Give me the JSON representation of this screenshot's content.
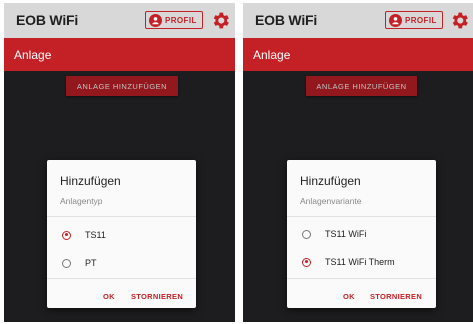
{
  "colors": {
    "accent": "#c42127",
    "topbar": "#d8d8d8",
    "background": "#27272a",
    "dialog": "#fafafa"
  },
  "screens": [
    {
      "app_title": "EOB WiFi",
      "profile_label": "PROFIL",
      "section_title": "Anlage",
      "add_button_label": "ANLAGE HINZUFÜGEN",
      "dialog": {
        "title": "Hinzufügen",
        "subtitle": "Anlagentyp",
        "options": [
          {
            "label": "TS11",
            "selected": true
          },
          {
            "label": "PT",
            "selected": false
          }
        ],
        "ok_label": "OK",
        "cancel_label": "STORNIEREN"
      }
    },
    {
      "app_title": "EOB WiFi",
      "profile_label": "PROFIL",
      "section_title": "Anlage",
      "add_button_label": "ANLAGE HINZUFÜGEN",
      "dialog": {
        "title": "Hinzufügen",
        "subtitle": "Anlagenvariante",
        "options": [
          {
            "label": "TS11 WiFi",
            "selected": false
          },
          {
            "label": "TS11 WiFi Therm",
            "selected": true
          }
        ],
        "ok_label": "OK",
        "cancel_label": "STORNIEREN"
      }
    }
  ],
  "icons": [
    "profile-person-icon",
    "gear-icon"
  ]
}
